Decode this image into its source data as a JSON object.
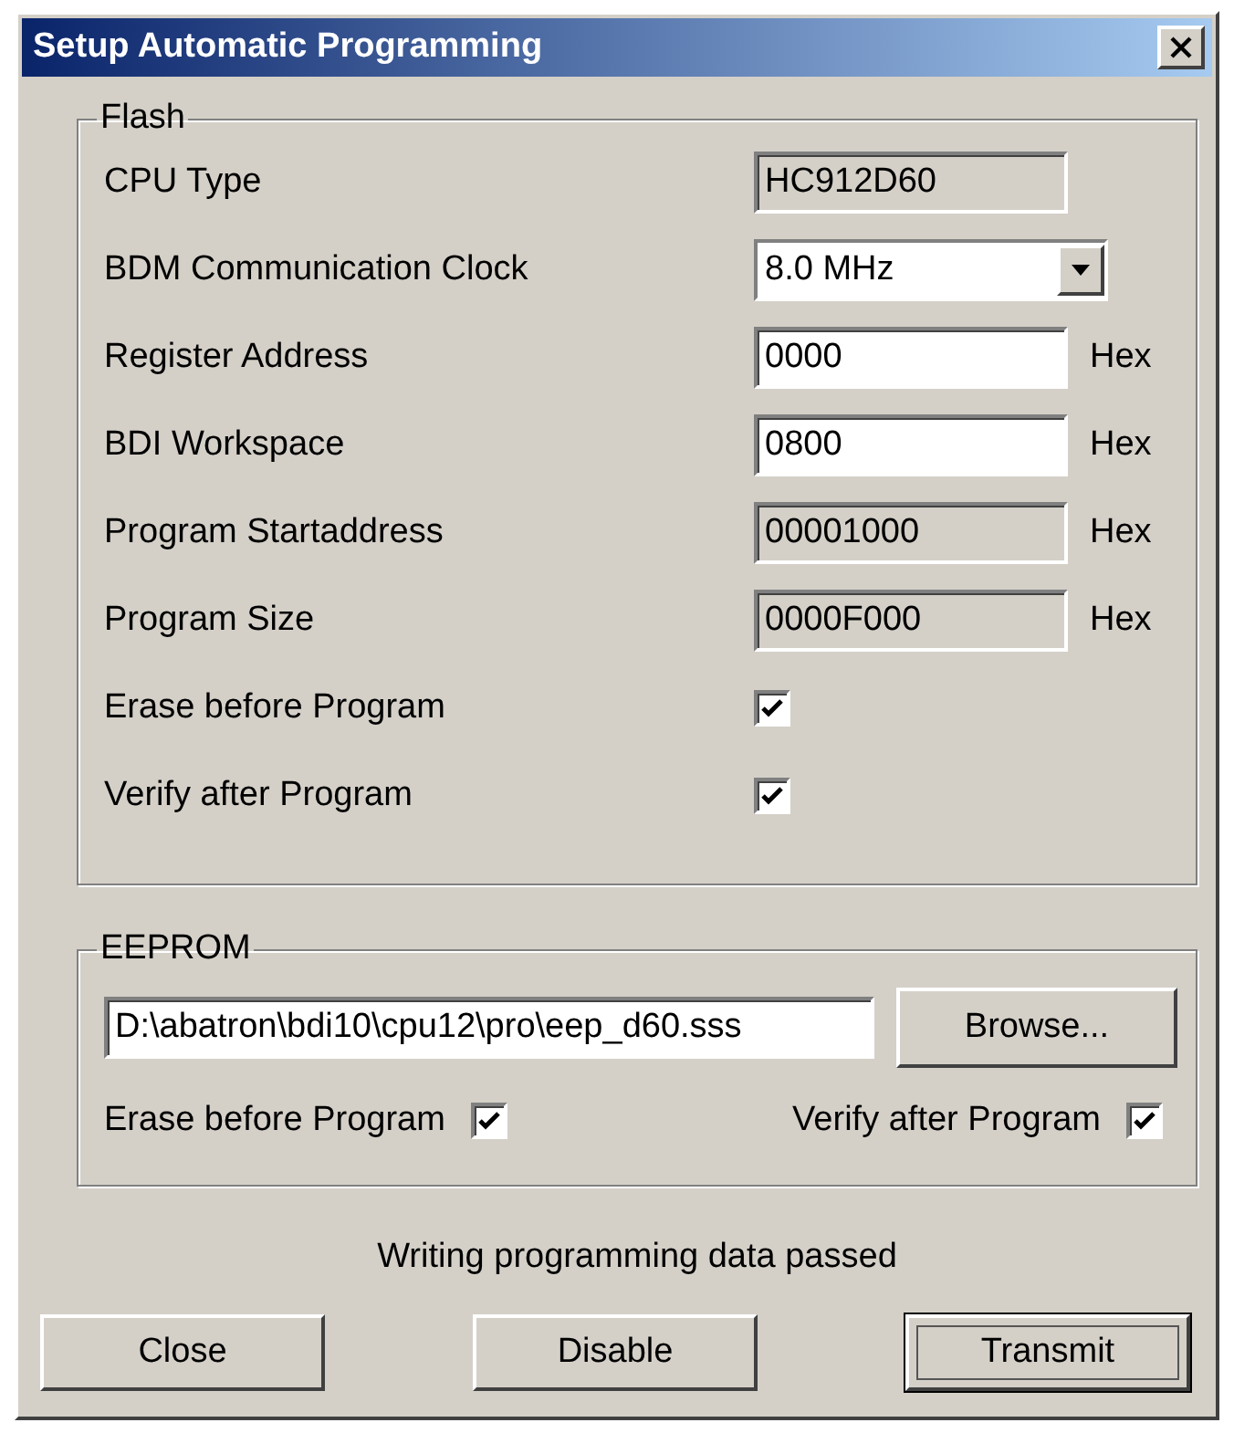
{
  "window": {
    "title": "Setup Automatic Programming"
  },
  "flash": {
    "title": "Flash",
    "rows": [
      {
        "kind": "field",
        "label": "CPU Type",
        "value": "HC912D60",
        "disabled": true
      },
      {
        "kind": "dropdown",
        "label": "BDM Communication Clock",
        "value": "8.0 MHz"
      },
      {
        "kind": "field",
        "label": "Register Address",
        "value": "0000",
        "disabled": false,
        "unit": "Hex"
      },
      {
        "kind": "field",
        "label": "BDI Workspace",
        "value": "0800",
        "disabled": false,
        "unit": "Hex"
      },
      {
        "kind": "field",
        "label": "Program Startaddress",
        "value": "00001000",
        "disabled": true,
        "unit": "Hex"
      },
      {
        "kind": "field",
        "label": "Program Size",
        "value": "0000F000",
        "disabled": true,
        "unit": "Hex"
      },
      {
        "kind": "checkbox",
        "label": "Erase before Program",
        "checked": true
      },
      {
        "kind": "checkbox",
        "label": "Verify after Program",
        "checked": true
      }
    ]
  },
  "eeprom": {
    "title": "EEPROM",
    "path": "D:\\abatron\\bdi10\\cpu12\\pro\\eep_d60.sss",
    "browse": "Browse...",
    "options": [
      {
        "label": "Erase before Program",
        "checked": true
      },
      {
        "label": "Verify after Program",
        "checked": true
      }
    ]
  },
  "status": "Writing programming data passed",
  "buttons": [
    {
      "label": "Close",
      "focused": false
    },
    {
      "label": "Disable",
      "focused": false
    },
    {
      "label": "Transmit",
      "focused": true
    }
  ]
}
